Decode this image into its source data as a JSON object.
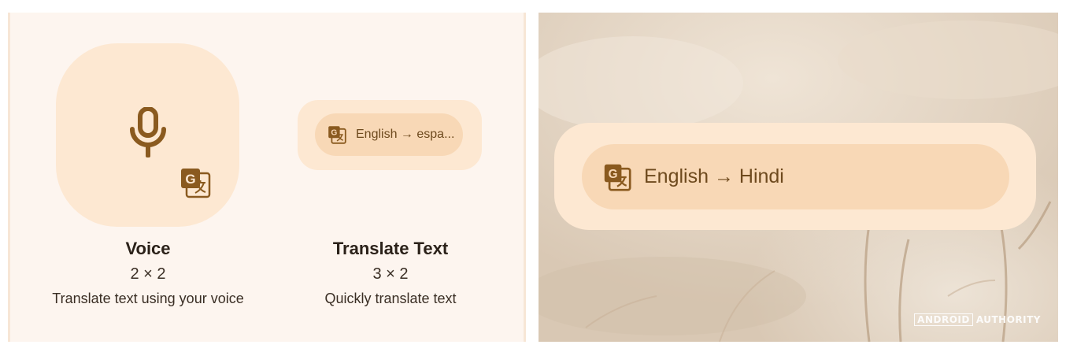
{
  "widgets": [
    {
      "name": "Voice",
      "size": "2 × 2",
      "description": "Translate text using your voice",
      "icon": "microphone-icon"
    },
    {
      "name": "Translate Text",
      "size": "3 × 2",
      "description": "Quickly translate text",
      "pill_text": "English → espa...",
      "icon": "google-translate-icon"
    }
  ],
  "homescreen_widget": {
    "text": "English → Hindi",
    "icon": "google-translate-icon"
  },
  "watermark": {
    "boxed": "ANDROID",
    "rest": "AUTHORITY"
  },
  "colors": {
    "accent": "#8a5a1f",
    "widget_bg": "#fde8d2",
    "pill_bg": "#f8d8b6"
  }
}
